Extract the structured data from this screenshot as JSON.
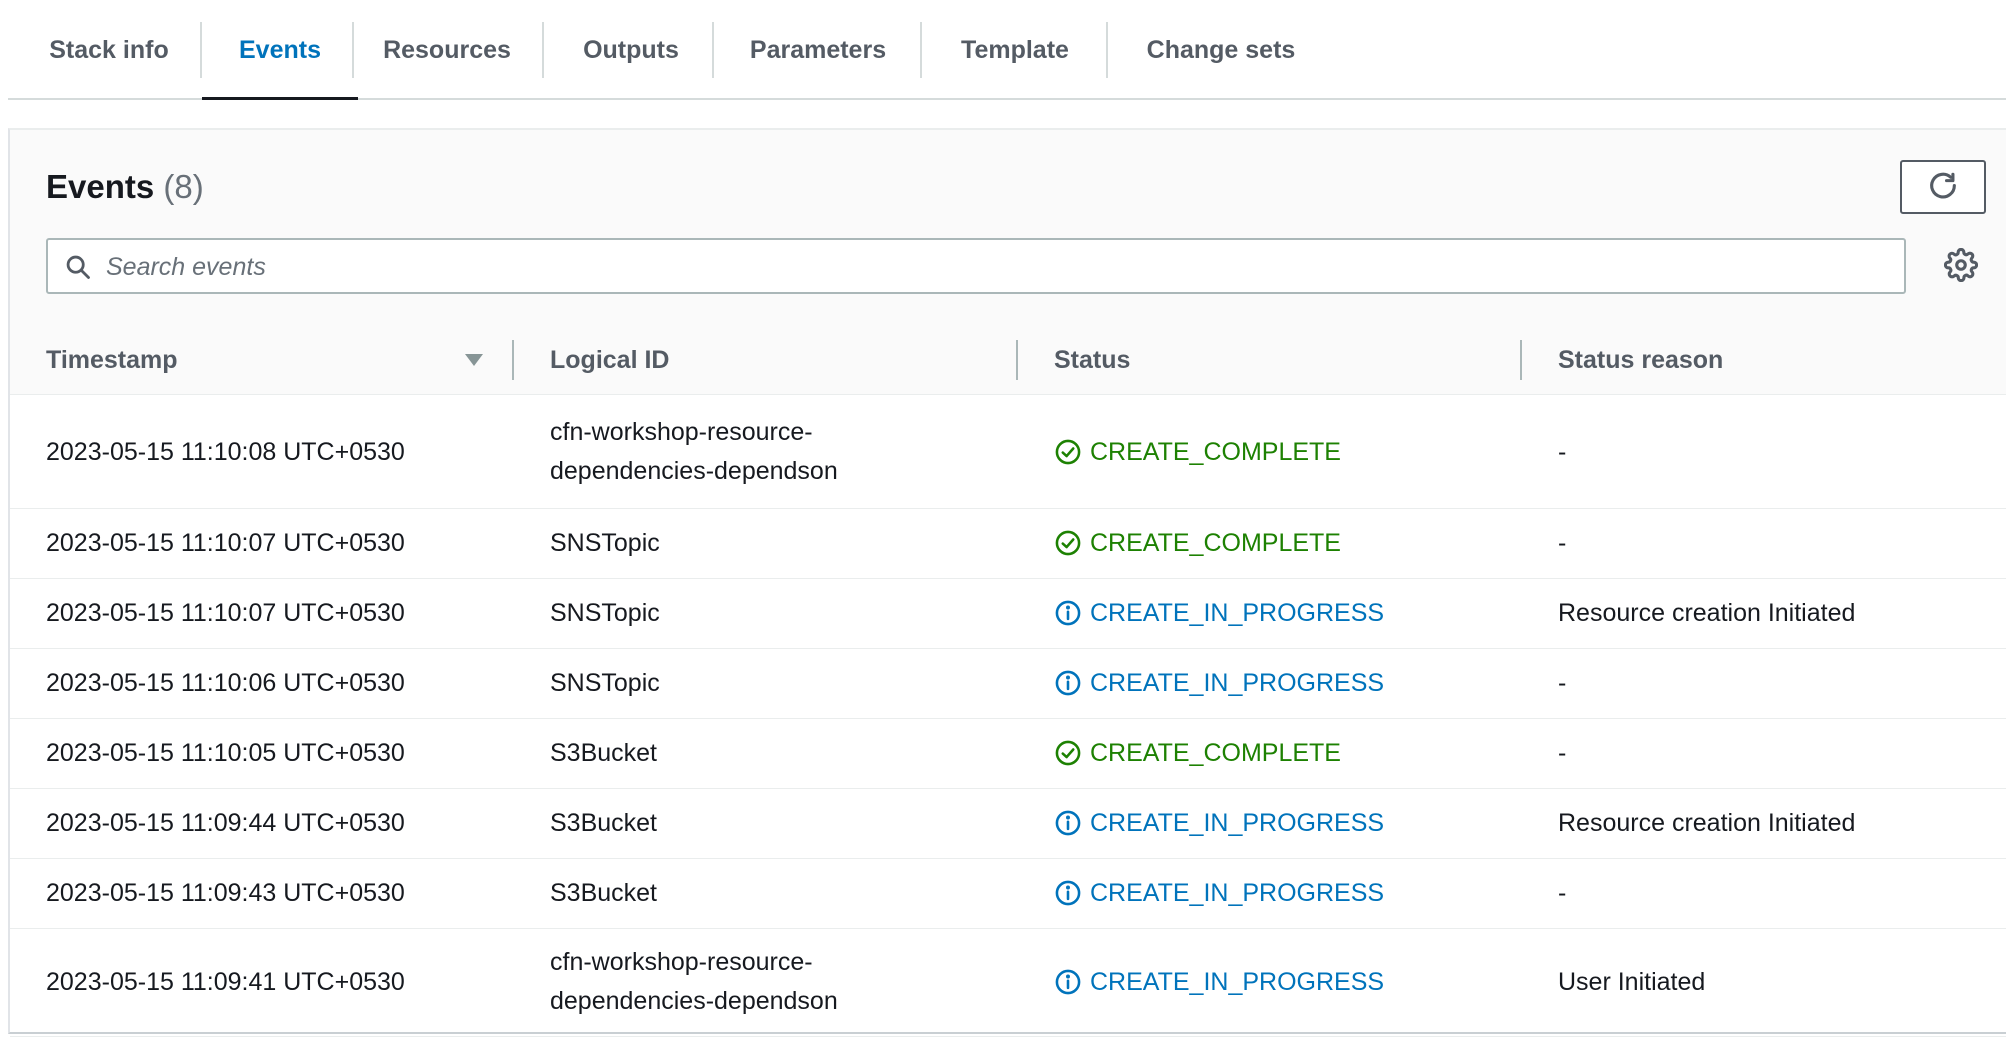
{
  "tabs": [
    {
      "label": "Stack info"
    },
    {
      "label": "Events"
    },
    {
      "label": "Resources"
    },
    {
      "label": "Outputs"
    },
    {
      "label": "Parameters"
    },
    {
      "label": "Template"
    },
    {
      "label": "Change sets"
    }
  ],
  "active_tab": "Events",
  "events_panel": {
    "title": "Events",
    "count": "(8)",
    "search": {
      "placeholder": "Search events",
      "value": ""
    },
    "refresh_icon": "refresh-icon",
    "settings_icon": "gear-icon"
  },
  "table": {
    "columns": [
      "Timestamp",
      "Logical ID",
      "Status",
      "Status reason"
    ],
    "sort_icon": "caret-down-icon",
    "rows": [
      {
        "timestamp": "2023-05-15 11:10:08 UTC+0530",
        "logical_id": "cfn-workshop-resource-dependencies-dependson",
        "status": "CREATE_COMPLETE",
        "reason": "-"
      },
      {
        "timestamp": "2023-05-15 11:10:07 UTC+0530",
        "logical_id": "SNSTopic",
        "status": "CREATE_COMPLETE",
        "reason": "-"
      },
      {
        "timestamp": "2023-05-15 11:10:07 UTC+0530",
        "logical_id": "SNSTopic",
        "status": "CREATE_IN_PROGRESS",
        "reason": "Resource creation Initiated"
      },
      {
        "timestamp": "2023-05-15 11:10:06 UTC+0530",
        "logical_id": "SNSTopic",
        "status": "CREATE_IN_PROGRESS",
        "reason": "-"
      },
      {
        "timestamp": "2023-05-15 11:10:05 UTC+0530",
        "logical_id": "S3Bucket",
        "status": "CREATE_COMPLETE",
        "reason": "-"
      },
      {
        "timestamp": "2023-05-15 11:09:44 UTC+0530",
        "logical_id": "S3Bucket",
        "status": "CREATE_IN_PROGRESS",
        "reason": "Resource creation Initiated"
      },
      {
        "timestamp": "2023-05-15 11:09:43 UTC+0530",
        "logical_id": "S3Bucket",
        "status": "CREATE_IN_PROGRESS",
        "reason": "-"
      },
      {
        "timestamp": "2023-05-15 11:09:41 UTC+0530",
        "logical_id": "cfn-workshop-resource-dependencies-dependson",
        "status": "CREATE_IN_PROGRESS",
        "reason": "User Initiated"
      }
    ]
  },
  "colors": {
    "complete": "#1d8102",
    "in_progress": "#0073bb",
    "active_tab": "#0073bb",
    "tab_text": "#545b64"
  }
}
